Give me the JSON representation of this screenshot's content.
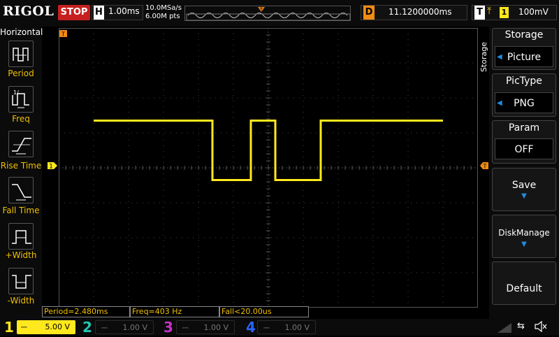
{
  "header": {
    "logo": "RIGOL",
    "run_state": "STOP",
    "timebase_letter": "H",
    "timebase": "1.00ms",
    "sample_rate": "10.0MSa/s",
    "memory_depth": "6.00M pts",
    "delay_letter": "D",
    "delay": "11.1200000ms",
    "trigger_letter": "T",
    "trigger_channel": "1",
    "trigger_level": "100mV"
  },
  "left_panel": {
    "title": "Horizontal",
    "items": [
      {
        "label": "Period",
        "icon": "period-icon"
      },
      {
        "label": "Freq",
        "icon": "freq-icon"
      },
      {
        "label": "Rise Time",
        "icon": "rise-time-icon"
      },
      {
        "label": "Fall Time",
        "icon": "fall-time-icon"
      },
      {
        "label": "+Width",
        "icon": "positive-width-icon"
      },
      {
        "label": "-Width",
        "icon": "negative-width-icon"
      }
    ]
  },
  "right_menu": {
    "vertical_title": "Storage",
    "title": "Storage",
    "storage_value": "Picture",
    "pictype_label": "PicType",
    "pictype_value": "PNG",
    "param_label": "Param",
    "param_value": "OFF",
    "save_label": "Save",
    "disk_manage_label": "DiskManage",
    "default_label": "Default"
  },
  "measurements": {
    "period": "Period=2.480ms",
    "freq": "Freq=403 Hz",
    "fall": "Fall<20.00us"
  },
  "channels": [
    {
      "num": "1",
      "scale": "5.00 V",
      "color": "#ffe81e",
      "active": true
    },
    {
      "num": "2",
      "scale": "1.00 V",
      "color": "#1ec8b4",
      "active": false
    },
    {
      "num": "3",
      "scale": "1.00 V",
      "color": "#c832c8",
      "active": false
    },
    {
      "num": "4",
      "scale": "1.00 V",
      "color": "#2864ff",
      "active": false
    }
  ],
  "colors": {
    "trace": "#ffe81e",
    "marker": "#f08c12",
    "stop": "#c61f1f"
  },
  "waveform": {
    "type": "line",
    "x_unit": "ms",
    "x": [
      -5.0,
      -1.6,
      -1.6,
      -1.0,
      -0.5,
      -0.5,
      0.2,
      0.2,
      0.3,
      0.3,
      1.5,
      1.5,
      5.0
    ],
    "y_div": [
      1.35,
      1.35,
      -0.35,
      -0.35,
      -0.35,
      1.35,
      1.35,
      -0.35,
      -0.35,
      -0.35,
      -0.35,
      1.35,
      1.35
    ]
  }
}
